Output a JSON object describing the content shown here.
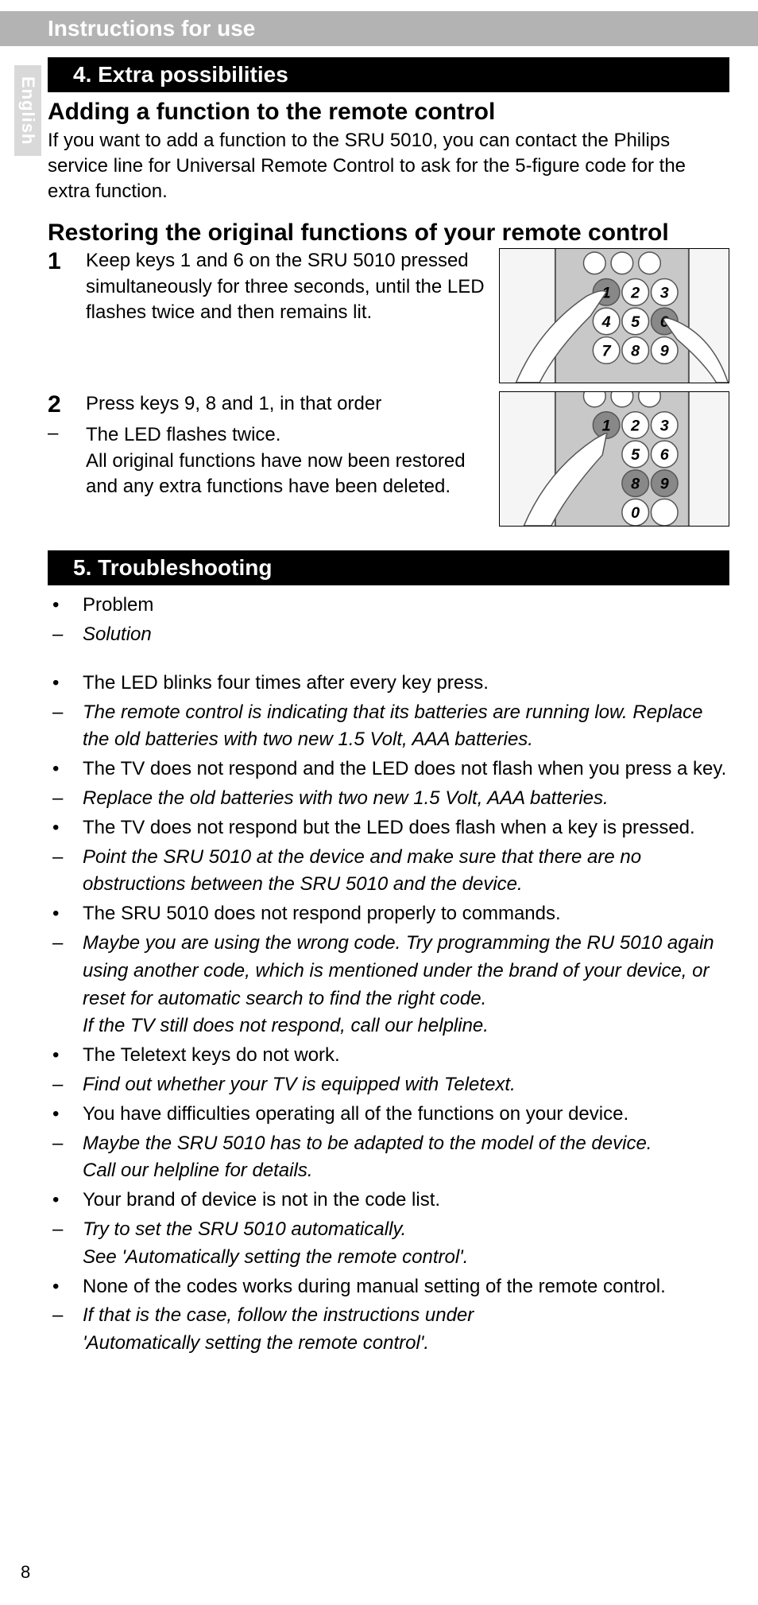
{
  "header": "Instructions for use",
  "langTab": "English",
  "pageNumber": "8",
  "section4": {
    "bar": "4. Extra possibilities",
    "h1": "Adding a function to the remote control",
    "p1": "If you want to add a function to the SRU 5010, you can contact the Philips service line for Universal Remote Control to ask for the 5-figure code for the extra function.",
    "h2": "Restoring the original functions of your remote control",
    "step1Num": "1",
    "step1a": "Keep keys 1 and 6 on the SRU 5010 pressed ",
    "step1b": "simultaneously for three seconds",
    "step1c": ", until the LED flashes twice and then remains lit.",
    "step2Num": "2",
    "step2": "Press keys 9, 8 and 1, in that order",
    "dash": "–",
    "step2dashA": "The LED flashes twice.",
    "step2dashB": "All original functions have now been restored and any extra functions have been deleted."
  },
  "section5": {
    "bar": "5. Troubleshooting",
    "bullet": "•",
    "dash": "–",
    "legendProblem": "Problem",
    "legendSolution": "Solution",
    "items": [
      {
        "p": "The LED blinks four times after every key press.",
        "s": "The remote control is indicating that its batteries are running low. Replace the old batteries with two new 1.5 Volt, AAA batteries."
      },
      {
        "p": "The TV does not respond and the LED does not flash when you press a key.",
        "s": "Replace the old batteries with two new 1.5 Volt, AAA batteries."
      },
      {
        "p": "The TV does not respond but the LED does flash when a key is pressed.",
        "s": "Point the SRU 5010 at the device and make sure that there are no obstructions between the SRU 5010 and the device."
      },
      {
        "p": "The SRU 5010 does not respond properly to commands.",
        "s": "Maybe you are using the wrong code. Try programming the RU 5010 again using another code, which is mentioned under the brand of your device, or reset for automatic search to find the right code.\nIf the TV still does not respond, call our helpline."
      },
      {
        "p": "The Teletext keys do not work.",
        "s": "Find out whether your TV is equipped with Teletext."
      },
      {
        "p": "You have difficulties operating all of the functions on your device.",
        "s": "Maybe the SRU 5010 has to be adapted to the model of the device.\nCall our helpline for details."
      },
      {
        "p": "Your brand of device is not in the code list.",
        "s": "Try to set the SRU 5010 automatically.\nSee 'Automatically setting the remote control'."
      },
      {
        "p": "None of the codes works during manual setting of the remote control.",
        "s": "If that is the case, follow the instructions under\n'Automatically setting the remote control'."
      }
    ]
  }
}
